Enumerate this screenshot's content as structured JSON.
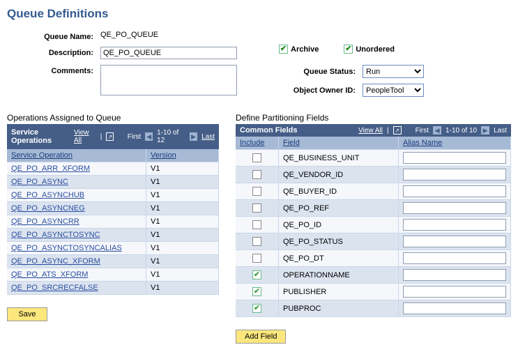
{
  "page_title": "Queue Definitions",
  "form": {
    "queue_name_label": "Queue Name:",
    "queue_name_value": "QE_PO_QUEUE",
    "description_label": "Description:",
    "description_value": "QE_PO_QUEUE",
    "comments_label": "Comments:",
    "comments_value": "",
    "archive_label": "Archive",
    "unordered_label": "Unordered",
    "queue_status_label": "Queue Status:",
    "queue_status_value": "Run",
    "object_owner_label": "Object Owner ID:",
    "object_owner_value": "PeopleTool"
  },
  "ops_section_title": "Operations Assigned to Queue",
  "ops_grid": {
    "title": "Service Operations",
    "view_all": "View All",
    "first": "First",
    "range": "1-10 of 12",
    "last": "Last",
    "col_service_op": "Service Operation",
    "col_version": "Version",
    "rows": [
      {
        "op": "QE_PO_ARR_XFORM",
        "ver": "V1"
      },
      {
        "op": "QE_PO_ASYNC",
        "ver": "V1"
      },
      {
        "op": "QE_PO_ASYNCHUB",
        "ver": "V1"
      },
      {
        "op": "QE_PO_ASYNCNEG",
        "ver": "V1"
      },
      {
        "op": "QE_PO_ASYNCRR",
        "ver": "V1"
      },
      {
        "op": "QE_PO_ASYNCTOSYNC",
        "ver": "V1"
      },
      {
        "op": "QE_PO_ASYNCTOSYNCALIAS",
        "ver": "V1"
      },
      {
        "op": "QE_PO_ASYNC_XFORM",
        "ver": "V1"
      },
      {
        "op": "QE_PO_ATS_XFORM",
        "ver": "V1"
      },
      {
        "op": "QE_PO_SRCRECFALSE",
        "ver": "V1"
      }
    ]
  },
  "part_section_title": "Define Partitioning Fields",
  "cf_grid": {
    "title": "Common Fields",
    "view_all": "View All",
    "first": "First",
    "range": "1-10 of 10",
    "last": "Last",
    "col_include": "Include",
    "col_field": "Field",
    "col_alias": "Alias Name",
    "rows": [
      {
        "include": false,
        "field": "QE_BUSINESS_UNIT",
        "alias": ""
      },
      {
        "include": false,
        "field": "QE_VENDOR_ID",
        "alias": ""
      },
      {
        "include": false,
        "field": "QE_BUYER_ID",
        "alias": ""
      },
      {
        "include": false,
        "field": "QE_PO_REF",
        "alias": ""
      },
      {
        "include": false,
        "field": "QE_PO_ID",
        "alias": ""
      },
      {
        "include": false,
        "field": "QE_PO_STATUS",
        "alias": ""
      },
      {
        "include": false,
        "field": "QE_PO_DT",
        "alias": ""
      },
      {
        "include": true,
        "field": "OPERATIONNAME",
        "alias": ""
      },
      {
        "include": true,
        "field": "PUBLISHER",
        "alias": ""
      },
      {
        "include": true,
        "field": "PUBPROC",
        "alias": ""
      }
    ]
  },
  "save_button": "Save",
  "add_field_button": "Add Field"
}
